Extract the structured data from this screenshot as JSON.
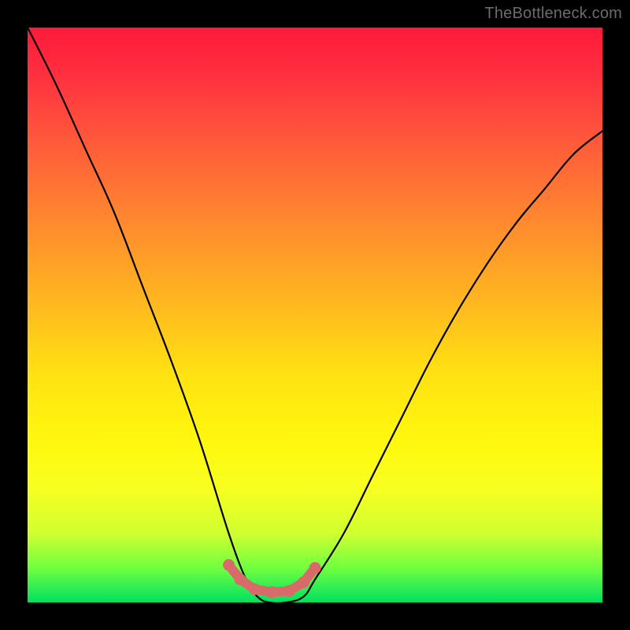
{
  "watermark": "TheBottleneck.com",
  "chart_data": {
    "type": "line",
    "title": "",
    "xlabel": "",
    "ylabel": "",
    "x": [
      0.0,
      0.05,
      0.1,
      0.15,
      0.2,
      0.25,
      0.3,
      0.35,
      0.38,
      0.4,
      0.42,
      0.45,
      0.48,
      0.5,
      0.55,
      0.6,
      0.65,
      0.7,
      0.75,
      0.8,
      0.85,
      0.9,
      0.95,
      1.0
    ],
    "values": [
      1.0,
      0.9,
      0.79,
      0.68,
      0.55,
      0.42,
      0.28,
      0.12,
      0.04,
      0.01,
      0.0,
      0.0,
      0.01,
      0.04,
      0.12,
      0.22,
      0.32,
      0.42,
      0.51,
      0.59,
      0.66,
      0.72,
      0.78,
      0.82
    ],
    "xlim": [
      0,
      1
    ],
    "ylim": [
      0,
      1
    ],
    "markers": {
      "x": [
        0.35,
        0.37,
        0.395,
        0.425,
        0.455,
        0.48,
        0.5
      ],
      "y": [
        0.065,
        0.04,
        0.023,
        0.018,
        0.02,
        0.035,
        0.06
      ]
    },
    "background_gradient": {
      "top": "#ff1a3a",
      "mid": "#ffe112",
      "bottom": "#00e060"
    }
  }
}
